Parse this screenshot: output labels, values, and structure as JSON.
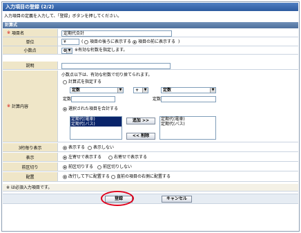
{
  "title": "入力項目の登録 (2/2)",
  "description": "入力項目の定義を入力して、「登録」ボタンを押してください。",
  "section_label": "計算式",
  "fields": {
    "item_name": {
      "label": "項目名",
      "required_mark": "※",
      "value": "定期代合計"
    },
    "unit": {
      "label": "単位",
      "value": "¥",
      "options": [
        "項目の後ろに表示する",
        "項目の前に表示する"
      ],
      "paren_open": "(",
      "paren_close": ")"
    },
    "decimal": {
      "label": "小数点",
      "value": "0",
      "arrow": "▼",
      "hint": "※有効な桁数を指定します。"
    },
    "explanation": {
      "label": "説明",
      "value": ""
    },
    "calc": {
      "label": "計算内容",
      "required_mark": "※",
      "note": "小数点以下は、有効な桁数で切り捨てられます。",
      "option_formula": "計算式を指定する",
      "operand_left": "定数",
      "operator": "+",
      "operand_right": "定数",
      "constant_label": "定数:",
      "option_sum": "選択された項目を合計する",
      "left_list": [
        "定期代(電車)",
        "定期代(バス)"
      ],
      "right_list": [
        "定期代(電車)",
        "定期代(バス)"
      ],
      "add_button": "追加 >>",
      "remove_button": "<< 削除",
      "arrow": "▼"
    },
    "thousands": {
      "label": "3桁毎り表示",
      "options": [
        "表示する",
        "表示しない"
      ]
    },
    "display": {
      "label": "表示",
      "options": [
        "左寄せで表示する",
        "右寄せで表示する"
      ]
    },
    "divider": {
      "label": "前区切り",
      "options": [
        "前区切りする",
        "前区切りしない"
      ]
    },
    "layout": {
      "label": "配置",
      "options": [
        "改行して下に配置する",
        "直前の項目の右側に配置する"
      ]
    }
  },
  "footer_note": "※ は必須入力項目です。",
  "buttons": {
    "register": "登録",
    "cancel": "キャンセル"
  },
  "colors": {
    "title_bar": "#2b5a9e",
    "label_bg": "#efe6c8",
    "highlight_circle": "#e0001a",
    "required": "#d40000"
  }
}
